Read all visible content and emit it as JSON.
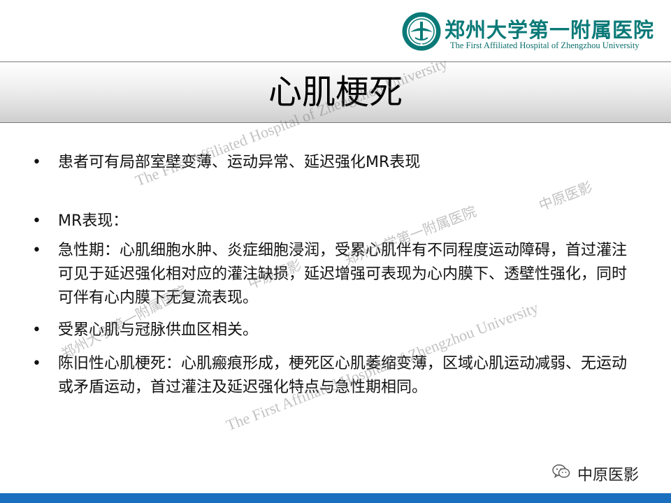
{
  "header": {
    "hospital_name_cn": "郑州大学第一附属医院",
    "hospital_name_en": "The First Affiliated Hospital of Zhengzhou University",
    "logo_icon": "hospital-seal-icon",
    "accent_color": "#0a7a78"
  },
  "slide": {
    "title": "心肌梗死",
    "bullet_symbol": "•",
    "bullets": [
      "患者可有局部室壁变薄、运动异常、延迟强化MR表现",
      "MR表现：",
      "急性期：心肌细胞水肿、炎症细胞浸润，受累心肌伴有不同程度运动障碍，首过灌注可见于延迟强化相对应的灌注缺损，延迟增强可表现为心内膜下、透壁性强化，同时可伴有心内膜下无复流表现。",
      "受累心肌与冠脉供血区相关。",
      "陈旧性心肌梗死：心肌瘢痕形成，梗死区心肌萎缩变薄，区域心肌运动减弱、无运动或矛盾运动，首过灌注及延迟强化特点与急性期相同。"
    ]
  },
  "watermarks": {
    "en": "The First Affiliated Hospital of Zhengzhou University",
    "cn_hospital": "郑州大学第一附属医院",
    "cn_brand": "中原医影"
  },
  "footer": {
    "wechat_icon": "wechat-icon",
    "label": "中原医影",
    "bar_color": "#1b6fbf"
  }
}
